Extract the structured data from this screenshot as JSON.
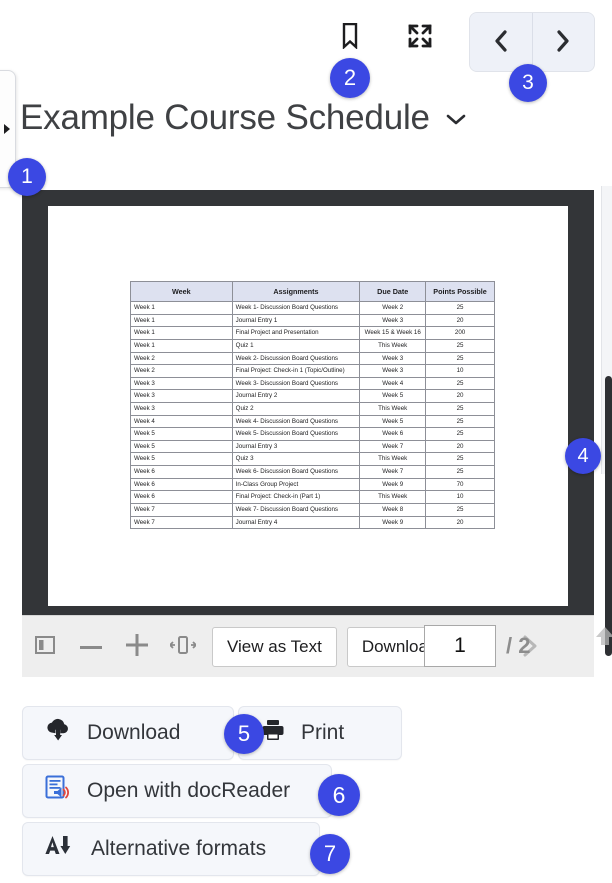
{
  "document": {
    "title": "Example Course Schedule"
  },
  "topbar": {
    "bookmark_label": "bookmark-icon",
    "fullscreen_label": "fullscreen-icon",
    "prev_label": "chevron-left-icon",
    "next_label": "chevron-right-icon"
  },
  "pdf_toolbar": {
    "sidebar_toggle_label": "sidebar-toggle-icon",
    "zoom_out_label": "minus-icon",
    "zoom_in_label": "plus-icon",
    "fit_width_label": "fit-width-icon",
    "view_as_text_label": "View as Text",
    "download_label": "Download",
    "page_number_value": "1",
    "page_total_label": "/ 2"
  },
  "actions": {
    "download_label": "Download",
    "print_label": "Print",
    "docreader_label": "Open with docReader",
    "alt_formats_label": "Alternative formats"
  },
  "badges": {
    "b1": "1",
    "b2": "2",
    "b3": "3",
    "b4": "4",
    "b5": "5",
    "b6": "6",
    "b7": "7"
  },
  "colors": {
    "badge_blue": "#3b48e3",
    "table_header_bg": "#dde1f0",
    "viewer_bg": "#333538",
    "action_bg": "#f5f7fb"
  },
  "table": {
    "headers": [
      "Week",
      "Assignments",
      "Due Date",
      "Points Possible"
    ],
    "rows": [
      [
        "Week 1",
        "Week 1- Discussion Board Questions",
        "Week 2",
        "25"
      ],
      [
        "Week 1",
        "Journal Entry 1",
        "Week 3",
        "20"
      ],
      [
        "Week 1",
        "Final Project and Presentation",
        "Week 15 & Week 16",
        "200"
      ],
      [
        "Week 1",
        "Quiz 1",
        "This Week",
        "25"
      ],
      [
        "Week 2",
        "Week 2- Discussion Board Questions",
        "Week 3",
        "25"
      ],
      [
        "Week 2",
        "Final Project: Check-in 1 (Topic/Outline)",
        "Week 3",
        "10"
      ],
      [
        "Week 3",
        "Week 3- Discussion Board Questions",
        "Week 4",
        "25"
      ],
      [
        "Week 3",
        "Journal Entry 2",
        "Week 5",
        "20"
      ],
      [
        "Week 3",
        "Quiz 2",
        "This Week",
        "25"
      ],
      [
        "Week 4",
        "Week 4- Discussion Board Questions",
        "Week 5",
        "25"
      ],
      [
        "Week 5",
        "Week 5- Discussion Board Questions",
        "Week 6",
        "25"
      ],
      [
        "Week 5",
        "Journal Entry 3",
        "Week 7",
        "20"
      ],
      [
        "Week 5",
        "Quiz 3",
        "This Week",
        "25"
      ],
      [
        "Week 6",
        "Week 6- Discussion Board Questions",
        "Week 7",
        "25"
      ],
      [
        "Week 6",
        "In-Class Group Project",
        "Week 9",
        "70"
      ],
      [
        "Week 6",
        "Final Project: Check-in (Part 1)",
        "This Week",
        "10"
      ],
      [
        "Week 7",
        "Week 7- Discussion Board Questions",
        "Week 8",
        "25"
      ],
      [
        "Week 7",
        "Journal Entry 4",
        "Week 9",
        "20"
      ]
    ]
  }
}
